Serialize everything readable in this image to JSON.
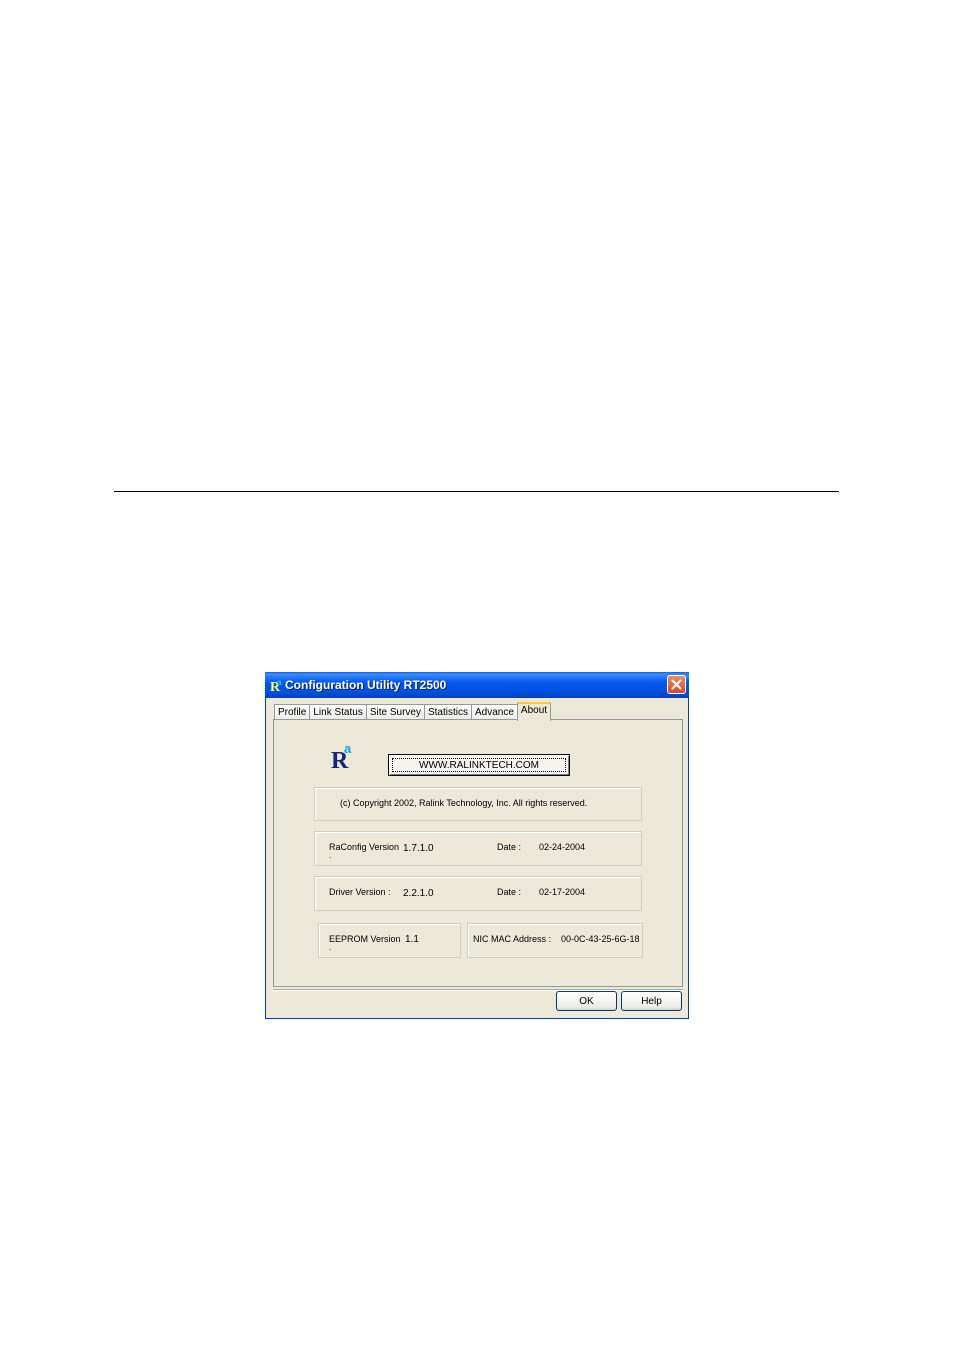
{
  "window": {
    "title": "Configuration Utility RT2500",
    "colors": {
      "titlebar": "#0058EE",
      "face": "#ECE9D8",
      "active_tab_highlight": "#FFC83C",
      "close_button": "#D5482A"
    }
  },
  "tabs": [
    {
      "label": "Profile",
      "active": false
    },
    {
      "label": "Link Status",
      "active": false
    },
    {
      "label": "Site Survey",
      "active": false
    },
    {
      "label": "Statistics",
      "active": false
    },
    {
      "label": "Advance",
      "active": false
    },
    {
      "label": "About",
      "active": true
    }
  ],
  "about": {
    "logo_icon": "ralink-logo-icon",
    "url_button_label": "WWW.RALINKTECH.COM",
    "copyright": "(c) Copyright 2002, Ralink Technology, Inc.  All rights reserved.",
    "raconfig": {
      "label": "RaConfig Version",
      "version": "1.7.1.0",
      "date_label": "Date :",
      "date": "02-24-2004"
    },
    "driver": {
      "label": "Driver Version :",
      "version": "2.2.1.0",
      "date_label": "Date :",
      "date": "02-17-2004"
    },
    "eeprom": {
      "label": "EEPROM Version",
      "version": "1.1"
    },
    "mac": {
      "label": "NIC MAC Address :",
      "value": "00-0C-43-25-6G-18"
    }
  },
  "buttons": {
    "ok": "OK",
    "help": "Help"
  }
}
